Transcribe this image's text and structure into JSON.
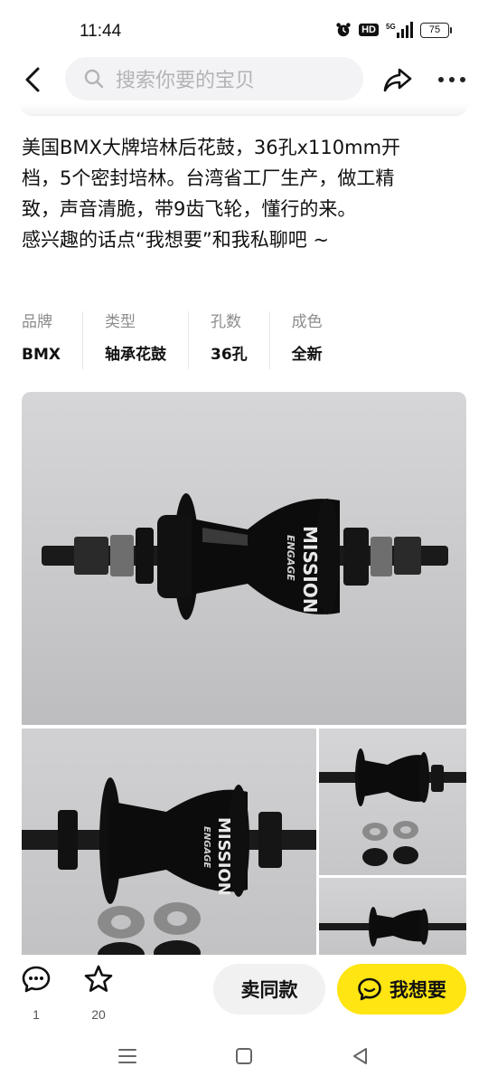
{
  "status": {
    "time": "11:44",
    "network": "5G",
    "hd": "HD",
    "battery": "75"
  },
  "nav": {
    "search_placeholder": "搜索你要的宝贝"
  },
  "description": {
    "lines": [
      "美国BMX大牌培林后花鼓，36孔x110mm开",
      "档，5个密封培林。台湾省工厂生产，做工精",
      "致，声音清脆，带9齿飞轮，懂行的来。",
      "感兴趣的话点“我想要”和我私聊吧 ~"
    ]
  },
  "attributes": [
    {
      "label": "品牌",
      "value": "BMX"
    },
    {
      "label": "类型",
      "value": "轴承花鼓"
    },
    {
      "label": "孔数",
      "value": "36孔"
    },
    {
      "label": "成色",
      "value": "全新"
    }
  ],
  "photos": {
    "hub_brand": "MISSION",
    "hub_model": "ENGAGE"
  },
  "actions": {
    "comment_count": "1",
    "favorite_count": "20",
    "same_item_label": "卖同款",
    "want_label": "我想要"
  },
  "colors": {
    "accent": "#ffe512",
    "background": "#ffffff",
    "search_bg": "#f3f3f5"
  }
}
